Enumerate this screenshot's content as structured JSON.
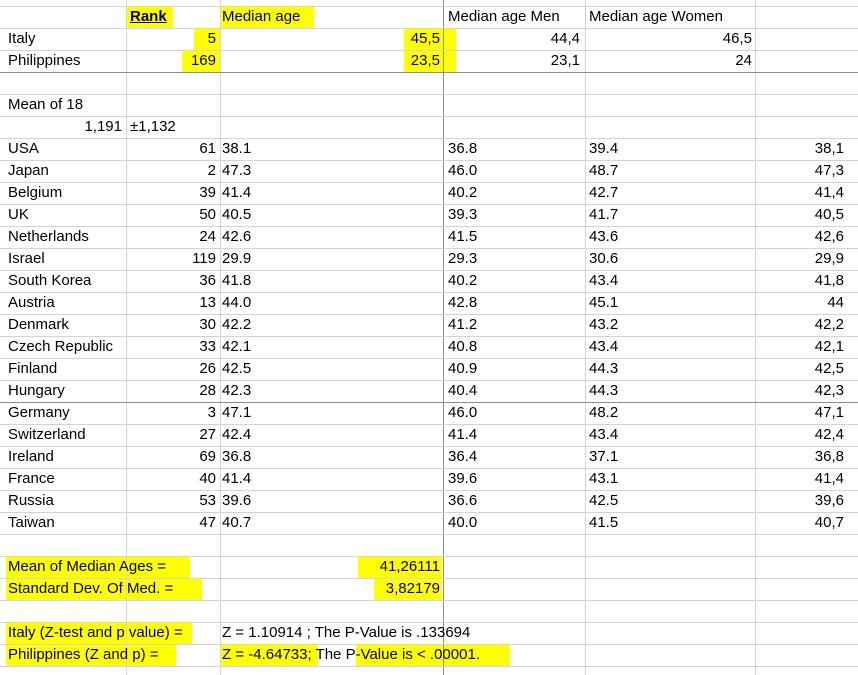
{
  "header": {
    "rank": "Rank",
    "median_age": "Median age",
    "median_age_men": "Median age Men",
    "median_age_women": "Median age Women"
  },
  "focus": [
    {
      "country": "Italy",
      "rank": "5",
      "median": "45,5",
      "men": "44,4",
      "women": "46,5"
    },
    {
      "country": "Philippines",
      "rank": "169",
      "median": "23,5",
      "men": "23,1",
      "women": "24"
    }
  ],
  "mean_label": "Mean of 18",
  "mean_rank": "1,191",
  "mean_sd": "±1,132",
  "colors": {
    "highlight": "#ffff00",
    "grid": "#d4d4d4",
    "grid_dark": "#8c8c8c"
  },
  "rows": [
    {
      "country": "USA",
      "rank": "61",
      "median": "38.1",
      "men": "36.8",
      "women": "39.4",
      "value": "38,1"
    },
    {
      "country": "Japan",
      "rank": "2",
      "median": "47.3",
      "men": "46.0",
      "women": "48.7",
      "value": "47,3"
    },
    {
      "country": "Belgium",
      "rank": "39",
      "median": "41.4",
      "men": "40.2",
      "women": "42.7",
      "value": "41,4"
    },
    {
      "country": "UK",
      "rank": "50",
      "median": "40.5",
      "men": "39.3",
      "women": "41.7",
      "value": "40,5"
    },
    {
      "country": "Netherlands",
      "rank": "24",
      "median": "42.6",
      "men": "41.5",
      "women": "43.6",
      "value": "42,6"
    },
    {
      "country": "Israel",
      "rank": "119",
      "median": "29.9",
      "men": "29.3",
      "women": "30.6",
      "value": "29,9"
    },
    {
      "country": "South Korea",
      "rank": "36",
      "median": "41.8",
      "men": "40.2",
      "women": "43.4",
      "value": "41,8"
    },
    {
      "country": "Austria",
      "rank": "13",
      "median": "44.0",
      "men": "42.8",
      "women": "45.1",
      "value": "44"
    },
    {
      "country": "Denmark",
      "rank": "30",
      "median": "42.2",
      "men": "41.2",
      "women": "43.2",
      "value": "42,2"
    },
    {
      "country": "Czech Republic",
      "rank": "33",
      "median": "42.1",
      "men": "40.8",
      "women": "43.4",
      "value": "42,1"
    },
    {
      "country": "Finland",
      "rank": "26",
      "median": "42.5",
      "men": "40.9",
      "women": "44.3",
      "value": "42,5"
    },
    {
      "country": "Hungary",
      "rank": "28",
      "median": "42.3",
      "men": "40.4",
      "women": "44.3",
      "value": "42,3"
    },
    {
      "country": "Germany",
      "rank": "3",
      "median": "47.1",
      "men": "46.0",
      "women": "48.2",
      "value": "47,1"
    },
    {
      "country": "Switzerland",
      "rank": "27",
      "median": "42.4",
      "men": "41.4",
      "women": "43.4",
      "value": "42,4"
    },
    {
      "country": "Ireland",
      "rank": "69",
      "median": "36.8",
      "men": "36.4",
      "women": "37.1",
      "value": "36,8"
    },
    {
      "country": "France",
      "rank": "40",
      "median": "41.4",
      "men": "39.6",
      "women": "43.1",
      "value": "41,4"
    },
    {
      "country": "Russia",
      "rank": "53",
      "median": "39.6",
      "men": "36.6",
      "women": "42.5",
      "value": "39,6"
    },
    {
      "country": "Taiwan",
      "rank": "47",
      "median": "40.7",
      "men": "40.0",
      "women": "41.5",
      "value": "40,7"
    }
  ],
  "stats": {
    "mean_label": "Mean of Median Ages =",
    "mean_value": "41,26111",
    "sd_label": "Standard Dev. Of Med. =",
    "sd_value": "3,82179"
  },
  "tests": {
    "italy_label": "Italy (Z-test and p value) =",
    "italy_result": "Z = 1.10914 ; The P-Value is .133694",
    "phil_label": "Philippines (Z and p) =",
    "phil_z": "Z = -4.64733",
    "phil_sep": "; The",
    "phil_p": "P-Value is < .00001",
    "phil_end": "."
  }
}
